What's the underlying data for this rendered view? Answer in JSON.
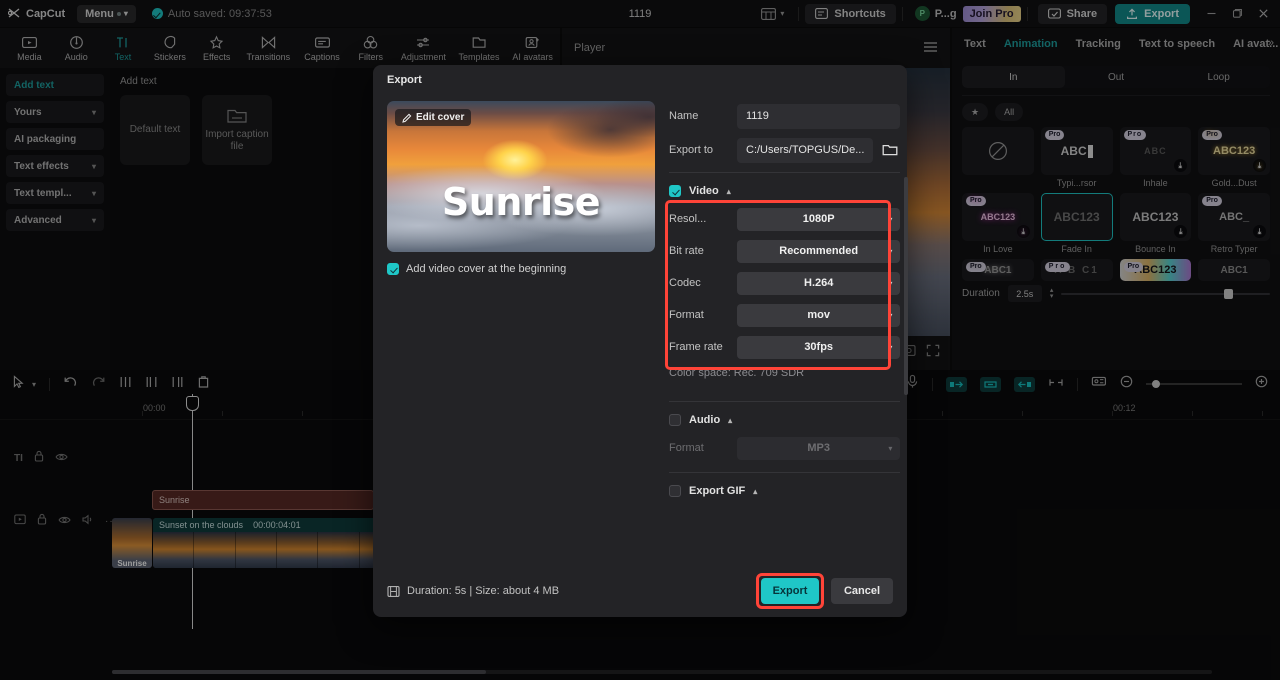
{
  "topbar": {
    "brand": "CapCut",
    "menu_label": "Menu",
    "autosave": "Auto saved: 09:37:53",
    "project_title": "1119",
    "shortcuts": "Shortcuts",
    "account_initial": "P",
    "account_name": "P...g",
    "join_pro": "Join Pro",
    "share": "Share",
    "export": "Export",
    "minimize_icon": "minimize-icon",
    "maximize_icon": "maximize-icon",
    "close_icon": "close-icon",
    "layout_icon": "layout-icon"
  },
  "tool_tabs": [
    {
      "label": "Media",
      "icon": "media-icon",
      "active": false
    },
    {
      "label": "Audio",
      "icon": "audio-icon",
      "active": false
    },
    {
      "label": "Text",
      "icon": "text-icon",
      "active": true
    },
    {
      "label": "Stickers",
      "icon": "stickers-icon",
      "active": false
    },
    {
      "label": "Effects",
      "icon": "effects-icon",
      "active": false
    },
    {
      "label": "Transitions",
      "icon": "transitions-icon",
      "active": false
    },
    {
      "label": "Captions",
      "icon": "captions-icon",
      "active": false
    },
    {
      "label": "Filters",
      "icon": "filters-icon",
      "active": false
    },
    {
      "label": "Adjustment",
      "icon": "adjustment-icon",
      "active": false
    },
    {
      "label": "Templates",
      "icon": "templates-icon",
      "active": false
    },
    {
      "label": "AI avatars",
      "icon": "ai-avatars-icon",
      "active": false
    }
  ],
  "left_panel": {
    "items": [
      {
        "label": "Add text",
        "active": true,
        "chevron": false
      },
      {
        "label": "Yours",
        "active": false,
        "chevron": true
      },
      {
        "label": "AI packaging",
        "active": false,
        "chevron": false
      },
      {
        "label": "Text effects",
        "active": false,
        "chevron": true
      },
      {
        "label": "Text templ...",
        "active": false,
        "chevron": true
      },
      {
        "label": "Advanced",
        "active": false,
        "chevron": true
      }
    ]
  },
  "library": {
    "title": "Add text",
    "cards": [
      {
        "label": "Default text",
        "icon": ""
      },
      {
        "label": "Import caption file",
        "icon": "folder-icon"
      }
    ]
  },
  "player": {
    "title": "Player",
    "menu_icon": "hamburger-icon",
    "fullscreen_icon": "fullscreen-icon",
    "ratio_icon": "ratio-icon"
  },
  "right_panel": {
    "tabs": [
      {
        "label": "Text",
        "active": false
      },
      {
        "label": "Animation",
        "active": true
      },
      {
        "label": "Tracking",
        "active": false
      },
      {
        "label": "Text to speech",
        "active": false
      },
      {
        "label": "AI avat...",
        "active": false
      }
    ],
    "segments": [
      {
        "label": "In",
        "active": true
      },
      {
        "label": "Out",
        "active": false
      },
      {
        "label": "Loop",
        "active": false
      }
    ],
    "filters": [
      {
        "label": "star-icon",
        "is_icon": true
      },
      {
        "label": "All",
        "is_icon": false
      }
    ],
    "animations": [
      {
        "label": "",
        "thumb": "none",
        "pro": false,
        "download": false,
        "selected": false,
        "preview": ""
      },
      {
        "label": "Typi...rsor",
        "thumb": "text",
        "pro": true,
        "download": false,
        "selected": false,
        "preview": "ABC"
      },
      {
        "label": "Inhale",
        "thumb": "text",
        "pro": true,
        "download": true,
        "selected": false,
        "preview": "ABC"
      },
      {
        "label": "Gold...Dust",
        "thumb": "text",
        "pro": true,
        "download": true,
        "selected": false,
        "preview": "ABC123"
      },
      {
        "label": "In Love",
        "thumb": "text",
        "pro": true,
        "download": true,
        "selected": false,
        "preview": "ABC123"
      },
      {
        "label": "Fade In",
        "thumb": "text",
        "pro": false,
        "download": false,
        "selected": true,
        "preview": "ABC123"
      },
      {
        "label": "Bounce In",
        "thumb": "text",
        "pro": false,
        "download": true,
        "selected": false,
        "preview": "ABC123"
      },
      {
        "label": "Retro Typer",
        "thumb": "text",
        "pro": true,
        "download": true,
        "selected": false,
        "preview": "ABC_"
      },
      {
        "label": "",
        "thumb": "text",
        "pro": true,
        "download": false,
        "selected": false,
        "preview": "ABC1"
      },
      {
        "label": "",
        "thumb": "text",
        "pro": true,
        "download": false,
        "selected": false,
        "preview": "A B C1"
      },
      {
        "label": "",
        "thumb": "text",
        "pro": true,
        "download": false,
        "selected": false,
        "preview": "ABC123"
      },
      {
        "label": "",
        "thumb": "text",
        "pro": false,
        "download": false,
        "selected": false,
        "preview": "ABC1"
      }
    ],
    "duration": {
      "label": "Duration",
      "value": "2.5s"
    }
  },
  "timeline": {
    "tools": [
      "select-icon",
      "chevron-down-icon",
      "undo-icon",
      "redo-icon",
      "split-icon",
      "trim-left-icon",
      "trim-right-icon",
      "delete-icon"
    ],
    "right_tools": [
      "mic-icon",
      "keyframe-prev-icon",
      "keyframe-icon",
      "keyframe-next-icon",
      "mask-icon",
      "snap-icon",
      "zoom-out-icon",
      "zoom-in-icon"
    ],
    "ruler_start": "00:00",
    "ruler_end": "00:12",
    "tracks": [
      {
        "type": "text",
        "icon": "text-track-icon",
        "controls": [
          "lock-icon",
          "eye-icon"
        ]
      },
      {
        "type": "video",
        "icon": "video-track-icon",
        "controls": [
          "lock-icon",
          "eye-icon",
          "volume-icon",
          "more-icon"
        ]
      }
    ],
    "text_clip": {
      "label": "Sunrise"
    },
    "video_clip": {
      "label": "Sunset on the clouds",
      "timecode": "00:00:04:01"
    },
    "cover_clip": {
      "label": "Sunrise"
    }
  },
  "export_dialog": {
    "title": "Export",
    "edit_cover": "Edit cover",
    "cover_title": "Sunrise",
    "add_cover_label": "Add video cover at the beginning",
    "add_cover_checked": true,
    "fields": [
      {
        "label": "Name",
        "value": "1119",
        "type": "text"
      },
      {
        "label": "Export to",
        "value": "C:/Users/TOPGUS/De...",
        "type": "path",
        "icon": "folder-icon"
      }
    ],
    "video_section": {
      "label": "Video",
      "checked": true,
      "collapse_icon": "caret-up-icon",
      "settings": [
        {
          "label": "Resol...",
          "value": "1080P"
        },
        {
          "label": "Bit rate",
          "value": "Recommended"
        },
        {
          "label": "Codec",
          "value": "H.264"
        },
        {
          "label": "Format",
          "value": "mov"
        },
        {
          "label": "Frame rate",
          "value": "30fps"
        }
      ],
      "color_space": "Color space: Rec. 709 SDR"
    },
    "audio_section": {
      "label": "Audio",
      "checked": false,
      "collapse_icon": "caret-up-icon",
      "settings": [
        {
          "label": "Format",
          "value": "MP3"
        }
      ]
    },
    "gif_section": {
      "label": "Export GIF",
      "checked": false,
      "collapse_icon": "caret-up-icon"
    },
    "footer": {
      "summary": "Duration: 5s | Size: about 4 MB",
      "summary_icon": "info-frame-icon",
      "export_label": "Export",
      "cancel_label": "Cancel"
    },
    "highlight_color": "#ff4438",
    "accent_color": "#1fc7c7"
  }
}
